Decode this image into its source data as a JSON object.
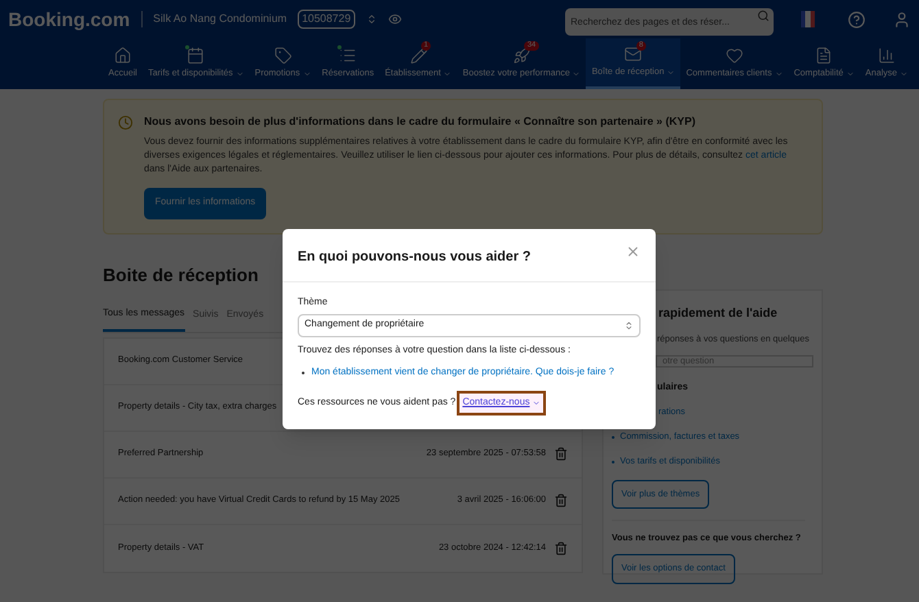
{
  "header": {
    "logo": "Booking.com",
    "property_name": "Silk Ao Nang Condominium",
    "property_id": "10508729",
    "search": {
      "placeholder": "Recherchez des pages et des réser..."
    }
  },
  "nav": [
    {
      "label": "Accueil",
      "caret": false,
      "dot": false,
      "selected": false
    },
    {
      "label": "Tarifs et disponibilités",
      "caret": true,
      "dot": true,
      "selected": false
    },
    {
      "label": "Promotions",
      "caret": true,
      "dot": false,
      "selected": false
    },
    {
      "label": "Réservations",
      "caret": false,
      "dot": true,
      "selected": false
    },
    {
      "label": "Établissement",
      "caret": true,
      "dot": false,
      "badge": "1",
      "selected": false
    },
    {
      "label": "Boostez votre performance",
      "caret": true,
      "dot": false,
      "badge": "34",
      "selected": false
    },
    {
      "label": "Boîte de réception",
      "caret": true,
      "dot": false,
      "badge": "8",
      "selected": true
    },
    {
      "label": "Commentaires clients",
      "caret": true,
      "dot": false,
      "selected": false
    },
    {
      "label": "Comptabilité",
      "caret": true,
      "dot": false,
      "selected": false
    },
    {
      "label": "Analyse",
      "caret": true,
      "dot": false,
      "selected": false
    }
  ],
  "banner": {
    "title": "Nous avons besoin de plus d'informations dans le cadre du formulaire « Connaître son partenaire » (KYP)",
    "text_before": "Vous devez fournir des informations supplémentaires relatives à votre établissement dans le cadre du formulaire KYP, afin d'être en conformité avec les diverses exigences légales et réglementaires. Veuillez utiliser le lien ci-dessous pour ajouter ces informations. Pour plus de détails, consultez",
    "link": "cet article",
    "text_after": "dans l'Aide aux partenaires.",
    "button": "Fournir les informations"
  },
  "inbox": {
    "title": "Boite de réception",
    "tabs": [
      {
        "label": "Tous les messages",
        "selected": true
      },
      {
        "label": "Suivis",
        "selected": false
      },
      {
        "label": "Envoyés",
        "selected": false
      }
    ],
    "rows": [
      {
        "subject": "Booking.com Customer Service"
      },
      {
        "subject": "Property details - City tax, extra charges"
      },
      {
        "subject": "Preferred Partnership",
        "date": "23 septembre 2025 - 07:53:58"
      },
      {
        "subject": "Action needed: you have Virtual Credit Cards to refund by 15 May 2025",
        "date": "3 avril 2025 - 16:06:00"
      },
      {
        "subject": "Property details - VAT",
        "date": "23 octobre 2024 - 12:42:14"
      }
    ]
  },
  "help_panel": {
    "title": "rapidement de l'aide",
    "subtitle": "réponses à vos questions en quelques",
    "search": {
      "placeholder": "otre question"
    },
    "topics_title": "ulaires",
    "topics": [
      "rations",
      "Commission, factures et taxes",
      "Vos tarifs et disponibilités"
    ],
    "more_button": "Voir plus de thèmes",
    "not_found": "Vous ne trouvez pas ce que vous cherchez ?",
    "contact_button": "Voir les options de contact"
  },
  "modal": {
    "title": "En quoi pouvons-nous vous aider ?",
    "theme_label": "Thème",
    "theme_value": "Changement de propriétaire",
    "hint": "Trouvez des réponses à votre question dans la liste ci-dessous :",
    "links": [
      "Mon établissement vient de changer de propriétaire. Que dois-je faire ?"
    ],
    "footer_text": "Ces ressources ne vous aident pas ?",
    "contact_link": {
      "label": "Contactez-nous",
      "focused": true
    }
  }
}
